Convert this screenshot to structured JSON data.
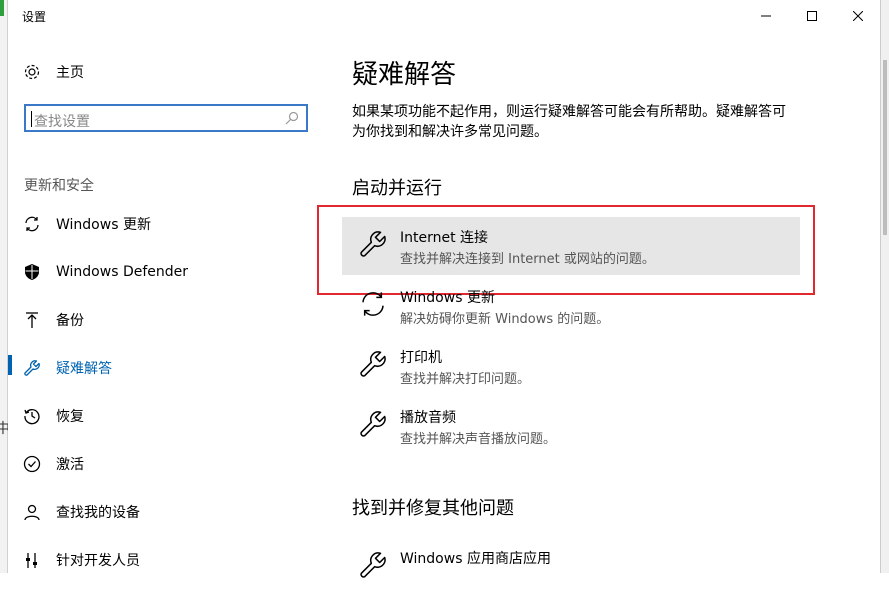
{
  "left_strip": {
    "partial_text": "中"
  },
  "window": {
    "title": "设置"
  },
  "sidebar": {
    "home_label": "主页",
    "search_placeholder": "查找设置",
    "section_label": "更新和安全",
    "items": [
      {
        "label": "Windows 更新",
        "icon": "sync-icon"
      },
      {
        "label": "Windows Defender",
        "icon": "shield-icon"
      },
      {
        "label": "备份",
        "icon": "backup-icon"
      },
      {
        "label": "疑难解答",
        "icon": "wrench-icon",
        "active": true
      },
      {
        "label": "恢复",
        "icon": "history-icon"
      },
      {
        "label": "激活",
        "icon": "check-circle-icon"
      },
      {
        "label": "查找我的设备",
        "icon": "person-pin-icon"
      },
      {
        "label": "针对开发人员",
        "icon": "developer-icon"
      }
    ]
  },
  "main": {
    "title": "疑难解答",
    "description": "如果某项功能不起作用，则运行疑难解答可能会有所帮助。疑难解答可为你找到和解决许多常见问题。",
    "section1": "启动并运行",
    "tiles": [
      {
        "title": "Internet 连接",
        "desc": "查找并解决连接到 Internet 或网站的问题。",
        "icon": "wrench-icon",
        "highlighted": true
      },
      {
        "title": "Windows 更新",
        "desc": "解决妨碍你更新 Windows 的问题。",
        "icon": "sync-icon"
      },
      {
        "title": "打印机",
        "desc": "查找并解决打印问题。",
        "icon": "wrench-icon"
      },
      {
        "title": "播放音频",
        "desc": "查找并解决声音播放问题。",
        "icon": "wrench-icon"
      }
    ],
    "section2": "找到并修复其他问题",
    "tiles2": [
      {
        "title": "Windows 应用商店应用",
        "icon": "wrench-icon"
      }
    ]
  },
  "colors": {
    "accent": "#0063b1",
    "highlight_border": "#e0282e",
    "tile_hover": "#e6e6e6"
  }
}
